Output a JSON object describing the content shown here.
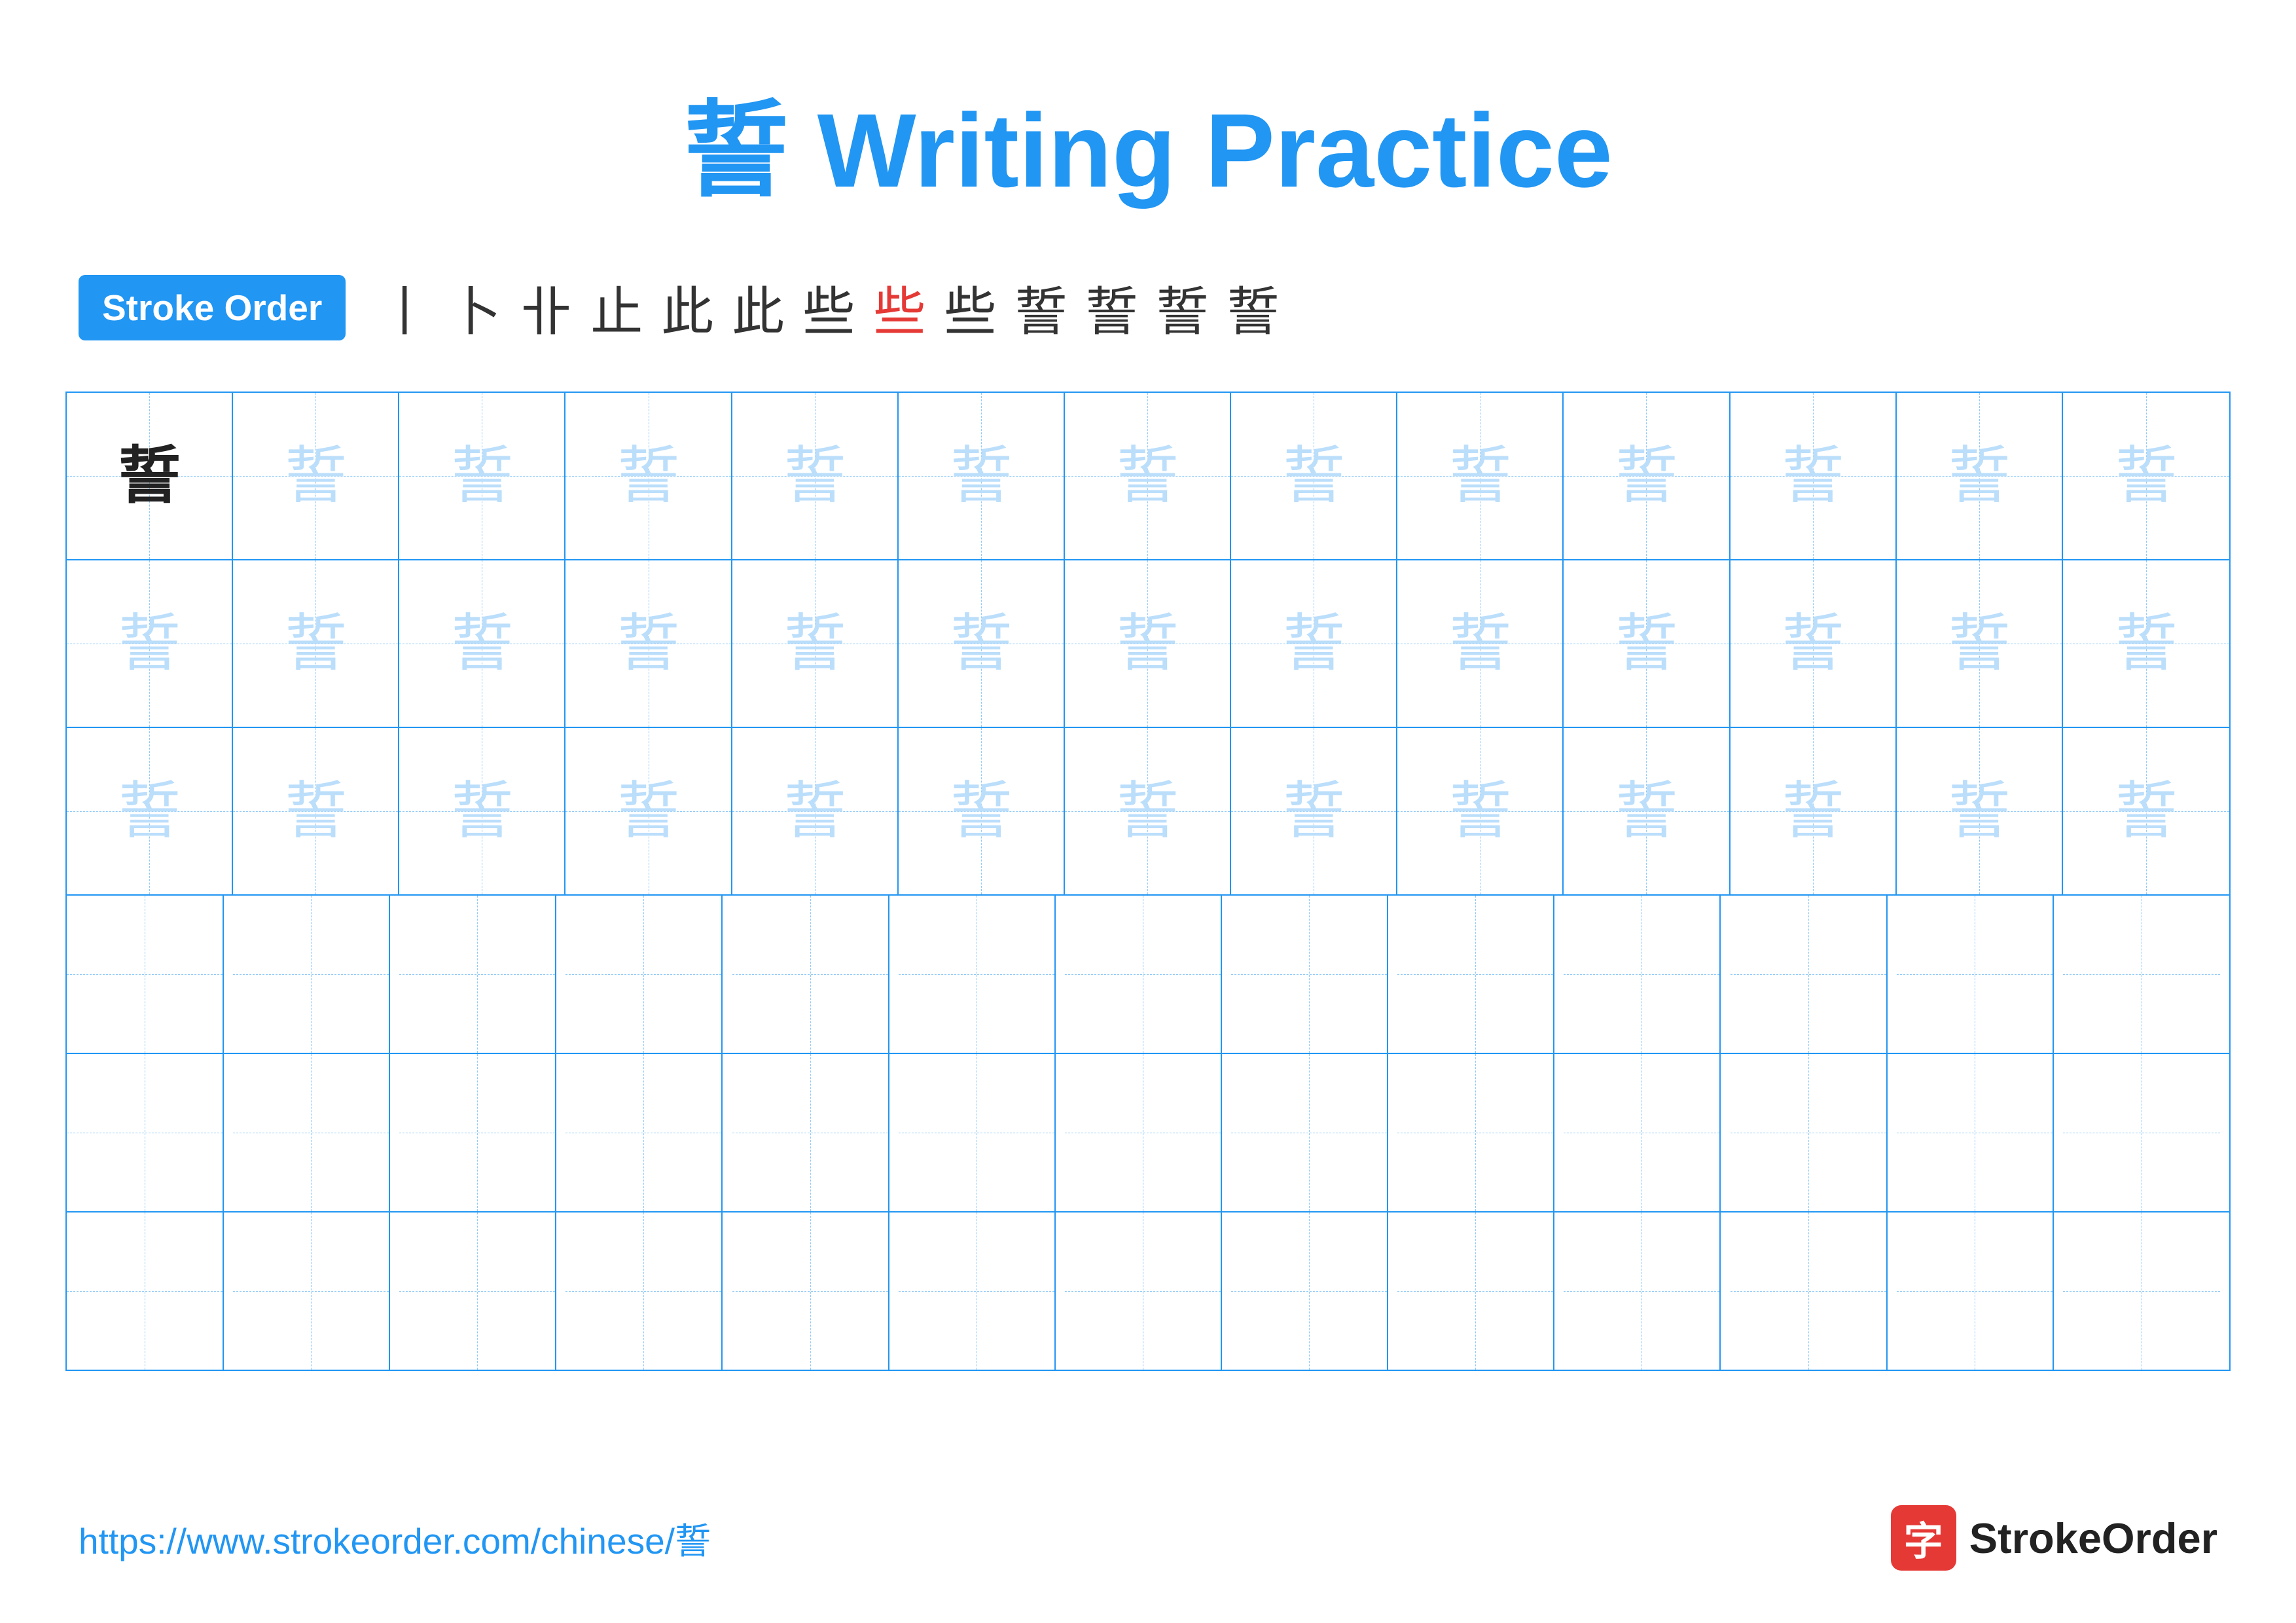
{
  "title": {
    "char": "誓",
    "label": "Writing Practice"
  },
  "stroke_order": {
    "badge": "Stroke Order",
    "strokes": [
      "丨",
      "卜",
      "卝",
      "止",
      "此",
      "此",
      "些",
      "些",
      "些",
      "誓",
      "誓",
      "誓",
      "誓"
    ],
    "red_index": 7
  },
  "grid": {
    "rows": 6,
    "cols": 13,
    "practice_char": "誓",
    "filled_rows": 3,
    "empty_rows": 3
  },
  "footer": {
    "url": "https://www.strokeorder.com/chinese/誓",
    "brand": "StrokeOrder",
    "logo_char": "字"
  }
}
